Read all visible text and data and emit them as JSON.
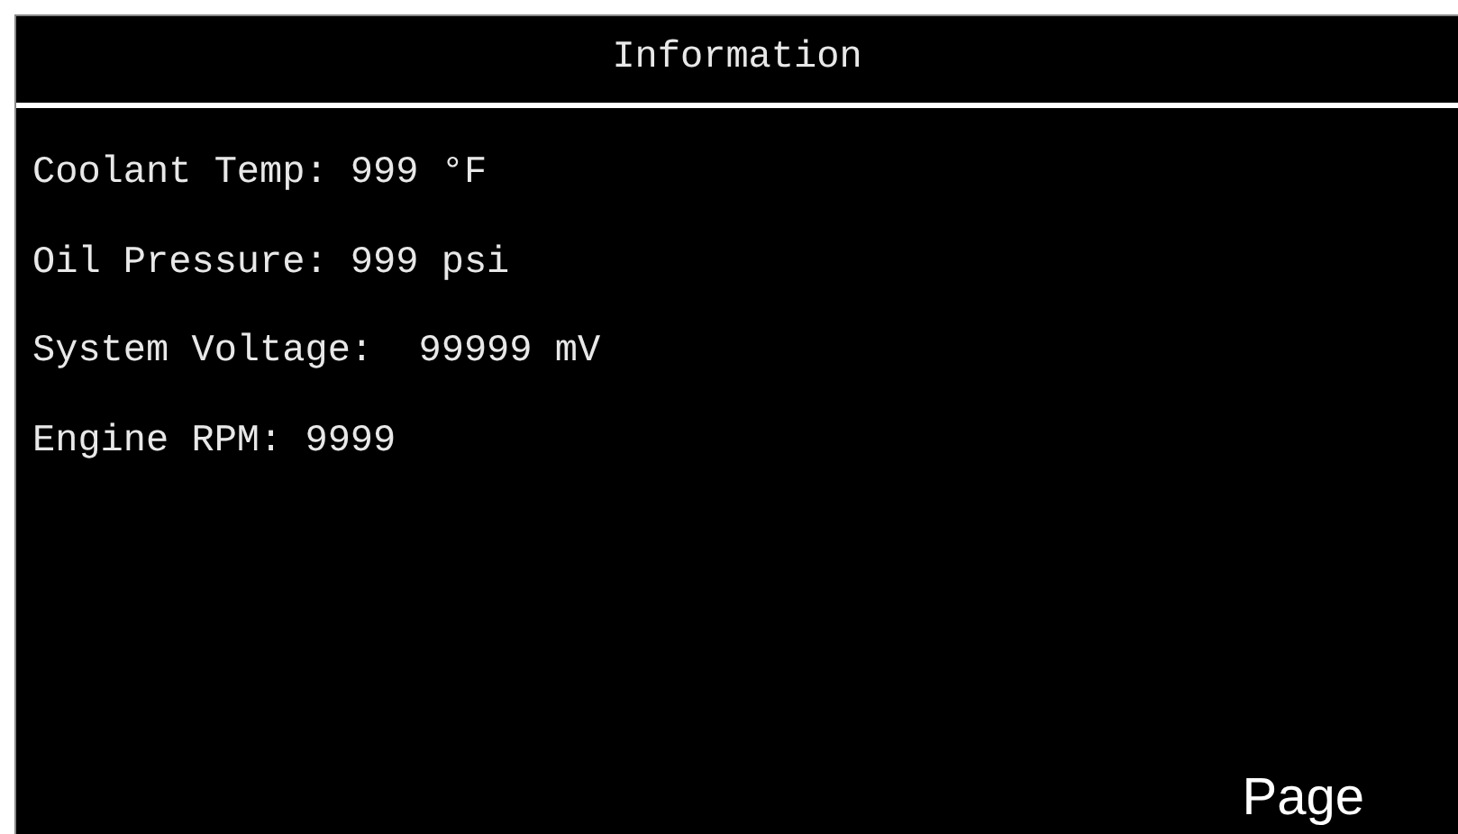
{
  "header": {
    "title": "Information"
  },
  "readings": [
    {
      "text": "Coolant Temp: 999 °F"
    },
    {
      "text": "Oil Pressure: 999 psi"
    },
    {
      "text": "System Voltage:  99999 mV"
    },
    {
      "text": "Engine RPM: 9999"
    }
  ],
  "softkeys": [
    "Page"
  ]
}
